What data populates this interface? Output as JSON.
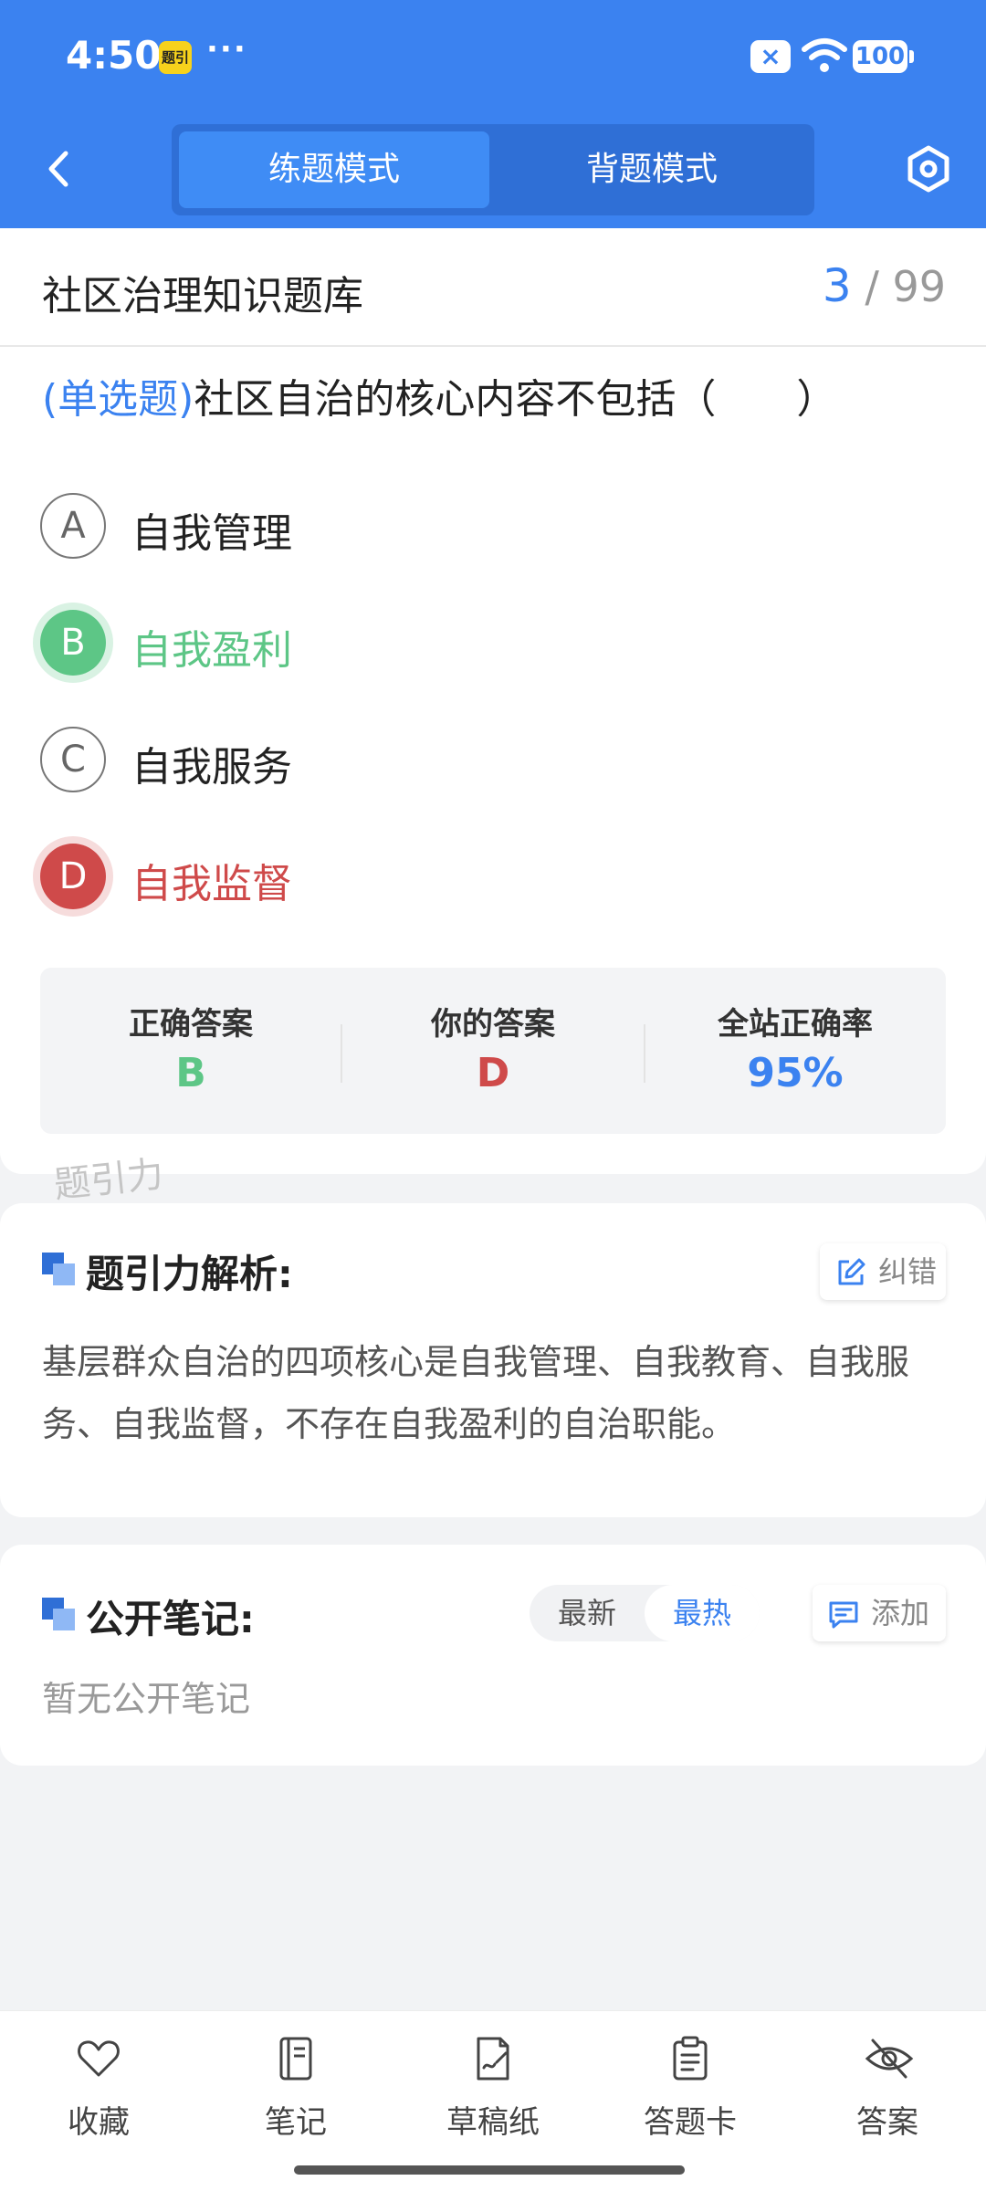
{
  "status": {
    "time": "4:50",
    "app_badge": "题引",
    "more": "···",
    "battery": "100"
  },
  "nav": {
    "modes": [
      "练题模式",
      "背题模式"
    ]
  },
  "header": {
    "title": "社区治理知识题库",
    "current": "3",
    "sep": "/",
    "total": "99"
  },
  "question": {
    "type": "(单选题)",
    "text": "社区自治的核心内容不包括（　　）"
  },
  "options": [
    {
      "letter": "A",
      "text": "自我管理",
      "state": "normal"
    },
    {
      "letter": "B",
      "text": "自我盈利",
      "state": "correct"
    },
    {
      "letter": "C",
      "text": "自我服务",
      "state": "normal"
    },
    {
      "letter": "D",
      "text": "自我监督",
      "state": "wrong"
    }
  ],
  "result": {
    "correct_label": "正确答案",
    "correct_value": "B",
    "yours_label": "你的答案",
    "yours_value": "D",
    "rate_label": "全站正确率",
    "rate_value": "95%"
  },
  "watermark": "题引力",
  "analysis": {
    "title": "题引力解析:",
    "report_label": "纠错",
    "body": "基层群众自治的四项核心是自我管理、自我教育、自我服务、自我监督，不存在自我盈利的自治职能。"
  },
  "notes": {
    "title": "公开笔记:",
    "sort_options": [
      "最新",
      "最热"
    ],
    "add_label": "添加",
    "empty_text": "暂无公开笔记"
  },
  "bottom_tabs": [
    {
      "label": "收藏",
      "icon": "heart-icon"
    },
    {
      "label": "笔记",
      "icon": "notebook-icon"
    },
    {
      "label": "草稿纸",
      "icon": "draft-icon"
    },
    {
      "label": "答题卡",
      "icon": "clipboard-icon"
    },
    {
      "label": "答案",
      "icon": "eye-off-icon"
    }
  ],
  "colors": {
    "primary": "#3b82f0",
    "correct": "#5dc686",
    "wrong": "#cf4a4a"
  }
}
